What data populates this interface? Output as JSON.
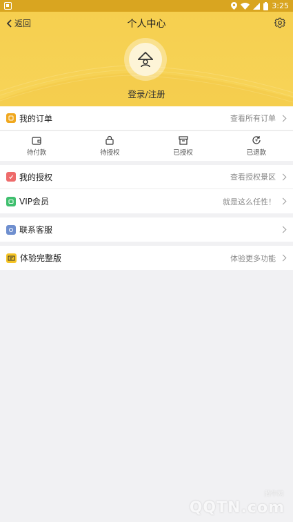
{
  "status_bar": {
    "time": "3:25"
  },
  "header": {
    "back_label": "返回",
    "title": "个人中心",
    "login_label": "登录/注册"
  },
  "orders": {
    "label": "我的订单",
    "right_text": "查看所有订单",
    "icon": "order-icon",
    "items": [
      {
        "label": "待付款",
        "icon": "wallet-icon"
      },
      {
        "label": "待授权",
        "icon": "lock-icon"
      },
      {
        "label": "已授权",
        "icon": "box-icon"
      },
      {
        "label": "已退款",
        "icon": "refund-icon"
      }
    ]
  },
  "menu": {
    "authorization": {
      "label": "我的授权",
      "right_text": "查看授权景区",
      "icon": "auth-icon"
    },
    "vip": {
      "label": "VIP会员",
      "right_text": "就是这么任性！",
      "icon": "vip-icon"
    },
    "service": {
      "label": "联系客服",
      "icon": "service-icon"
    },
    "full_version": {
      "label": "体验完整版",
      "right_text": "体验更多功能",
      "icon": "full-version-icon"
    }
  },
  "watermark": {
    "text": "QQTN.com",
    "small": "腾牛网"
  },
  "colors": {
    "header_yellow": "#f6cf4f",
    "status_bar": "#d9a520",
    "orders_icon": "#f0a81f",
    "auth_icon": "#ee6b6b",
    "vip_icon": "#3fbf6e",
    "service_icon": "#6f8fcf",
    "full_version_icon": "#f5c425"
  }
}
